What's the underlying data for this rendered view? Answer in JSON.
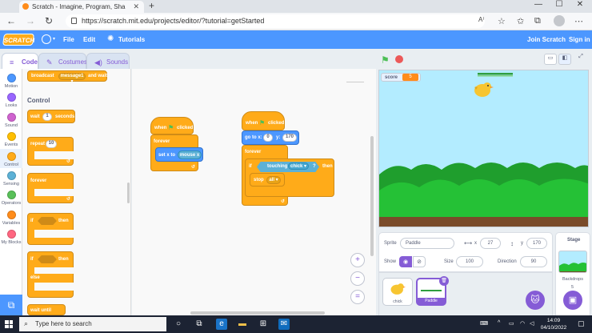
{
  "browser": {
    "tab_title": "Scratch - Imagine, Program, Sha",
    "url": "https://scratch.mit.edu/projects/editor/?tutorial=getStarted"
  },
  "menu": {
    "logo": "SCRATCH",
    "file": "File",
    "edit": "Edit",
    "tutorials": "Tutorials",
    "join": "Join Scratch",
    "signin": "Sign in"
  },
  "editor_tabs": {
    "code": "Code",
    "costumes": "Costumes",
    "sounds": "Sounds"
  },
  "categories": [
    {
      "label": "Motion",
      "color": "#4c97ff"
    },
    {
      "label": "Looks",
      "color": "#9966ff"
    },
    {
      "label": "Sound",
      "color": "#cf63cf"
    },
    {
      "label": "Events",
      "color": "#ffbf00"
    },
    {
      "label": "Control",
      "color": "#ffab19"
    },
    {
      "label": "Sensing",
      "color": "#5cb1d6"
    },
    {
      "label": "Operators",
      "color": "#59c059"
    },
    {
      "label": "Variables",
      "color": "#ff8c1a"
    },
    {
      "label": "My Blocks",
      "color": "#ff6680"
    }
  ],
  "palette": {
    "broadcast_block": "broadcast",
    "broadcast_msg": "message1 ▾",
    "broadcast_suffix": "and wait",
    "section_title": "Control",
    "wait": "wait",
    "wait_value": "1",
    "wait_suffix": "seconds",
    "repeat": "repeat",
    "repeat_value": "10",
    "forever": "forever",
    "if": "if",
    "then": "then",
    "if2": "if",
    "then2": "then",
    "else": "else",
    "wait_until": "wait until"
  },
  "script1": {
    "hat": "when",
    "hat_suffix": "clicked",
    "forever": "forever",
    "set_x": "set x to",
    "mouse_x": "mouse x"
  },
  "script2": {
    "hat": "when",
    "hat_suffix": "clicked",
    "goto": "go to x:",
    "x_val": "0",
    "y_lbl": "y:",
    "y_val": "170",
    "forever": "forever",
    "if": "if",
    "touching": "touching",
    "touching_target": "chick ▾",
    "question": "?",
    "then": "then",
    "stop": "stop",
    "stop_opt": "all ▾"
  },
  "stage": {
    "score_label": "score",
    "score_value": "5"
  },
  "sprite_info": {
    "sprite_label": "Sprite",
    "sprite_name": "Paddle",
    "x_label": "x",
    "x_value": "27",
    "y_label": "y",
    "y_value": "170",
    "show_label": "Show",
    "size_label": "Size",
    "size_value": "100",
    "direction_label": "Direction",
    "direction_value": "90"
  },
  "sprites": [
    {
      "name": "chick"
    },
    {
      "name": "Paddle"
    }
  ],
  "stage_panel": {
    "title": "Stage",
    "backdrops_label": "Backdrops",
    "backdrops_count": "5"
  },
  "taskbar": {
    "search_placeholder": "Type here to search",
    "time": "14:09",
    "date": "04/10/2022"
  }
}
